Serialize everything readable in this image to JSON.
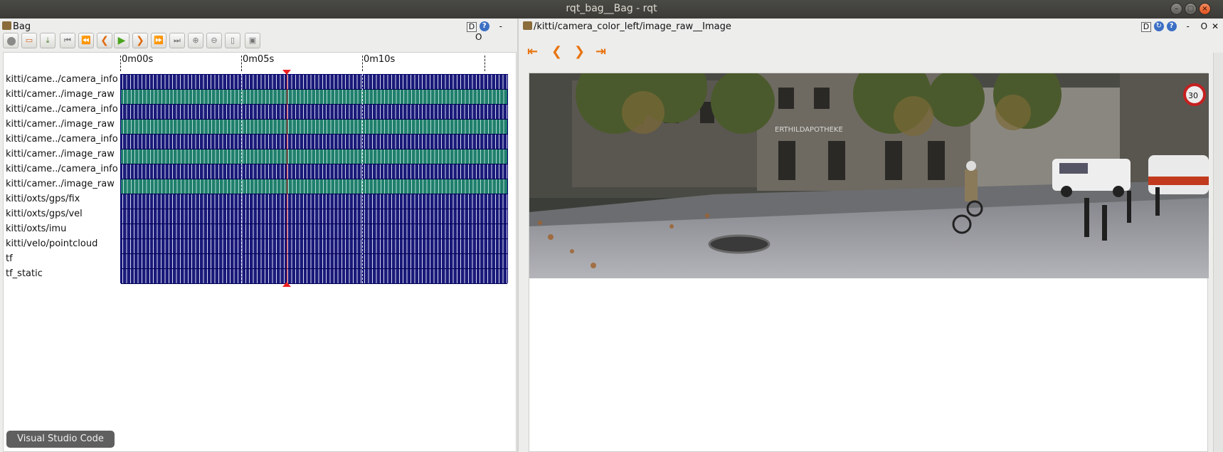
{
  "window": {
    "title": "rqt_bag__Bag - rqt"
  },
  "bag_panel": {
    "title": "Bag",
    "d_label": "D",
    "help_glyph": "?",
    "dash": "-",
    "o_label": "O"
  },
  "toolbar": {
    "buttons": [
      {
        "name": "record",
        "icon": "record-icon"
      },
      {
        "name": "open",
        "icon": "folder-open-icon"
      },
      {
        "name": "save",
        "icon": "save-icon"
      },
      {
        "name": "go-start",
        "icon": "skip-start-icon",
        "glyph": "⏮"
      },
      {
        "name": "rewind",
        "icon": "rewind-icon",
        "glyph": "⏪"
      },
      {
        "name": "step-back",
        "icon": "step-back-icon",
        "glyph": "❮"
      },
      {
        "name": "play",
        "icon": "play-icon",
        "glyph": "▶"
      },
      {
        "name": "step-forward",
        "icon": "step-forward-icon",
        "glyph": "❯"
      },
      {
        "name": "fast-forward",
        "icon": "fast-forward-icon",
        "glyph": "⏩"
      },
      {
        "name": "go-end",
        "icon": "skip-end-icon",
        "glyph": "⏭"
      },
      {
        "name": "zoom-in",
        "icon": "zoom-in-icon",
        "glyph": "⊕"
      },
      {
        "name": "zoom-out",
        "icon": "zoom-out-icon",
        "glyph": "⊖"
      },
      {
        "name": "zoom-reset",
        "icon": "zoom-reset-icon",
        "glyph": "▯"
      },
      {
        "name": "thumbnails",
        "icon": "thumbnail-icon",
        "glyph": "▣"
      }
    ]
  },
  "timeline": {
    "ticks": [
      "0m00s",
      "0m05s",
      "0m10s"
    ],
    "playhead_fraction": 0.43,
    "topics": [
      {
        "label": "kitti/came../camera_info",
        "color": "blue"
      },
      {
        "label": "kitti/camer../image_raw",
        "color": "teal"
      },
      {
        "label": "kitti/came../camera_info",
        "color": "blue"
      },
      {
        "label": "kitti/camer../image_raw",
        "color": "teal"
      },
      {
        "label": "kitti/came../camera_info",
        "color": "blue"
      },
      {
        "label": "kitti/camer../image_raw",
        "color": "teal"
      },
      {
        "label": "kitti/came../camera_info",
        "color": "blue"
      },
      {
        "label": "kitti/camer../image_raw",
        "color": "teal"
      },
      {
        "label": "kitti/oxts/gps/fix",
        "color": "blue"
      },
      {
        "label": "kitti/oxts/gps/vel",
        "color": "blue"
      },
      {
        "label": "kitti/oxts/imu",
        "color": "blue"
      },
      {
        "label": "kitti/velo/pointcloud",
        "color": "blue"
      },
      {
        "label": "tf",
        "color": "blue"
      },
      {
        "label": "tf_static",
        "color": "blue"
      }
    ]
  },
  "tooltip": {
    "text": "Visual Studio Code"
  },
  "image_panel": {
    "title": "/kitti/camera_color_left/image_raw__Image",
    "d_label": "D",
    "refresh_glyph": "↻",
    "help_glyph": "?",
    "dash": "-",
    "o_label": "O",
    "close_glyph": "✕",
    "nav": [
      {
        "name": "first",
        "icon": "first-frame-icon",
        "glyph": "⇤"
      },
      {
        "name": "prev",
        "icon": "prev-frame-icon",
        "glyph": "❮"
      },
      {
        "name": "next",
        "icon": "next-frame-icon",
        "glyph": "❯"
      },
      {
        "name": "last",
        "icon": "last-frame-icon",
        "glyph": "⇥"
      }
    ],
    "photo_sign": "ERTHILDAPOTHEKE",
    "speed_sign": "30"
  },
  "colors": {
    "blue_topic": "#1a1a7a",
    "teal_topic": "#1f7f6c",
    "playhead": "#ee2020",
    "nav_accent": "#e8740e"
  }
}
